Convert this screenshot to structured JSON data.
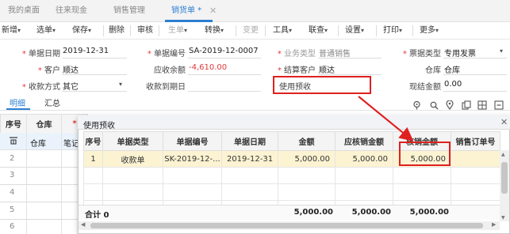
{
  "tabs": [
    {
      "label": "我的桌面"
    },
    {
      "label": "往来现金"
    },
    {
      "label": "销售管理"
    },
    {
      "label": "销货单 *"
    }
  ],
  "toolbar": {
    "items": [
      "新增",
      "选单",
      "保存",
      "删除",
      "审核",
      "生单",
      "转换",
      "变更",
      "工具",
      "联查",
      "设置",
      "打印",
      "更多"
    ]
  },
  "form": {
    "doc_date": {
      "label": "单据日期",
      "value": "2019-12-31"
    },
    "doc_no": {
      "label": "单据编号",
      "value": "SA-2019-12-0007"
    },
    "biz_type": {
      "label": "业务类型",
      "value": "普通销售"
    },
    "invoice_type": {
      "label": "票据类型",
      "value": "专用发票"
    },
    "customer": {
      "label": "客户",
      "value": "顺达"
    },
    "receivable": {
      "label": "应收余额",
      "value": "-4,610.00"
    },
    "settle_customer": {
      "label": "结算客户",
      "value": "顺达"
    },
    "warehouse": {
      "label": "仓库",
      "value": "仓库"
    },
    "pay_method": {
      "label": "收款方式",
      "value": "其它"
    },
    "due_date": {
      "label": "收款到期日",
      "value": ""
    },
    "use_prepay": {
      "label": "使用预收",
      "value": ""
    },
    "cash_amount": {
      "label": "现结金额",
      "value": "0.00"
    }
  },
  "subtabs": {
    "detail": "明细",
    "summary": "汇总"
  },
  "background_grid": {
    "headers": [
      "序号",
      "仓库",
      "*"
    ],
    "row1": {
      "wh": "仓库",
      "note": "笔记"
    },
    "row_numbers": [
      "2",
      "3",
      "4",
      "5",
      "6"
    ]
  },
  "dialog": {
    "title": "使用预收",
    "headers": [
      "序号",
      "单据类型",
      "单据编号",
      "单据日期",
      "金额",
      "应核销金额",
      "核销金额",
      "销售订单号"
    ],
    "rows": [
      {
        "no": "1",
        "type": "收款单",
        "doc_no": "SK-2019-12-...",
        "date": "2019-12-31",
        "amount": "5,000.00",
        "due": "5,000.00",
        "write_off": "5,000.00",
        "order": ""
      }
    ],
    "footer": {
      "label": "合计 0",
      "amount": "5,000.00",
      "due": "5,000.00",
      "write_off": "5,000.00"
    }
  },
  "colors": {
    "accent": "#2d7fd1",
    "highlight_row": "#fcf3d2",
    "annotation": "#e02020",
    "negative": "#e03a3a"
  }
}
